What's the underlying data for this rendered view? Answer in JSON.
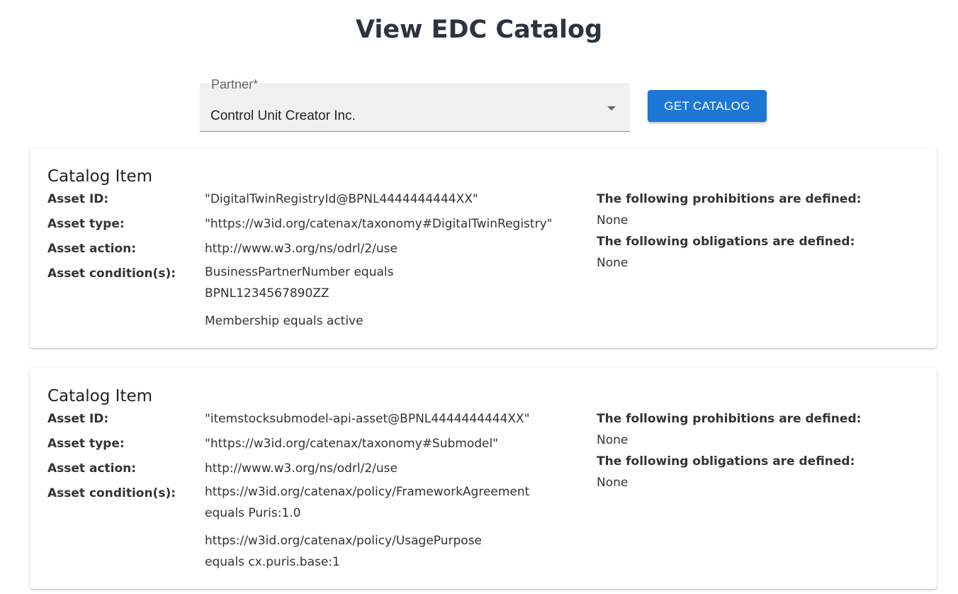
{
  "page": {
    "title": "View EDC Catalog"
  },
  "partner_select": {
    "label": "Partner*",
    "value": "Control Unit Creator Inc."
  },
  "get_catalog_button": {
    "label": "GET CATALOG"
  },
  "colors": {
    "accent": "#1e76d6",
    "title": "#2c3441"
  },
  "catalog_items": [
    {
      "title": "Catalog Item",
      "asset_id_label": "Asset ID:",
      "asset_id": "\"DigitalTwinRegistryId@BPNL4444444444XX\"",
      "asset_type_label": "Asset type:",
      "asset_type": "\"https://w3id.org/catenax/taxonomy#DigitalTwinRegistry\"",
      "asset_action_label": "Asset action:",
      "asset_action": "http://www.w3.org/ns/odrl/2/use",
      "asset_conditions_label": "Asset condition(s):",
      "conditions": [
        "BusinessPartnerNumber equals BPNL1234567890ZZ",
        "Membership equals active"
      ],
      "prohibitions_heading": "The following prohibitions are defined:",
      "prohibitions_value": "None",
      "obligations_heading": "The following obligations are defined:",
      "obligations_value": "None"
    },
    {
      "title": "Catalog Item",
      "asset_id_label": "Asset ID:",
      "asset_id": "\"itemstocksubmodel-api-asset@BPNL4444444444XX\"",
      "asset_type_label": "Asset type:",
      "asset_type": "\"https://w3id.org/catenax/taxonomy#Submodel\"",
      "asset_action_label": "Asset action:",
      "asset_action": "http://www.w3.org/ns/odrl/2/use",
      "asset_conditions_label": "Asset condition(s):",
      "conditions": [
        "https://w3id.org/catenax/policy/FrameworkAgreement equals Puris:1.0",
        "https://w3id.org/catenax/policy/UsagePurpose equals cx.puris.base:1"
      ],
      "prohibitions_heading": "The following prohibitions are defined:",
      "prohibitions_value": "None",
      "obligations_heading": "The following obligations are defined:",
      "obligations_value": "None"
    }
  ]
}
